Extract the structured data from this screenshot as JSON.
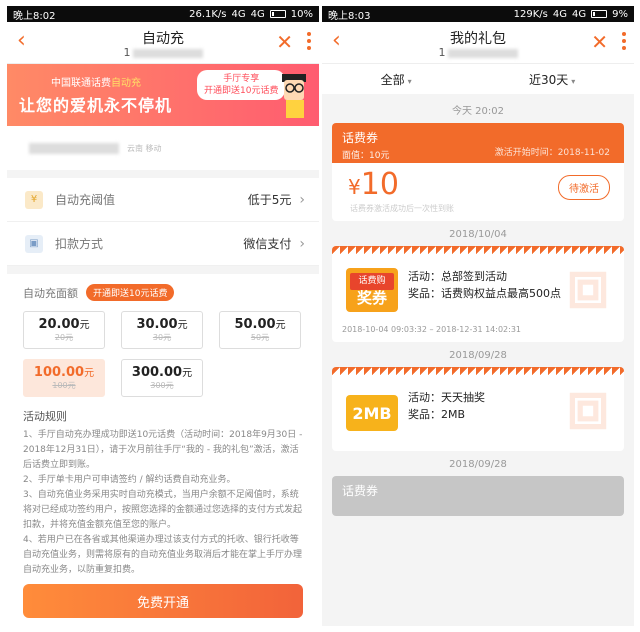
{
  "left": {
    "status": {
      "time": "晚上8:02",
      "net": "26.1K/s",
      "signal": "4G",
      "signal2": "4G",
      "battery": "10%"
    },
    "nav": {
      "title": "自动充",
      "subtitle": "1"
    },
    "banner": {
      "small_prefix": "中国联通话费",
      "small_highlight": "自动充",
      "headline": "让您的爱机永不停机",
      "bubble_line1": "手厅专享",
      "bubble_line2": "开通即送10元话费"
    },
    "account": {
      "location": "云南 移动"
    },
    "rows": [
      {
        "label": "自动充阈值",
        "value": "低于5元",
        "icon": "yen-coin-icon"
      },
      {
        "label": "扣款方式",
        "value": "微信支付",
        "icon": "bag-icon"
      }
    ],
    "amount": {
      "label": "自动充面额",
      "promo": "开通即送10元话费",
      "options": [
        {
          "price": "20.00",
          "unit": "元",
          "orig": "20元"
        },
        {
          "price": "30.00",
          "unit": "元",
          "orig": "30元"
        },
        {
          "price": "50.00",
          "unit": "元",
          "orig": "50元"
        },
        {
          "price": "100.00",
          "unit": "元",
          "orig": "100元"
        },
        {
          "price": "300.00",
          "unit": "元",
          "orig": "300元"
        }
      ]
    },
    "rules": {
      "title": "活动规则",
      "items": [
        "1、手厅自动充办理成功即送10元话费（活动时间：2018年9月30日 - 2018年12月31日），请于次月前往手厅“我的 - 我的礼包”激活，激活后话费立即到账。",
        "2、手厅单卡用户可申请签约 / 解约话费自动充业务。",
        "3、自动充值业务采用实时自动充模式，当用户余额不足阈值时，系统将对已经成功签约用户，按照您选择的金额通过您选择的支付方式发起扣款，并将充值金额充值至您的账户。",
        "4、若用户已在各省或其他渠道办理过该支付方式的托收、银行托收等自动充值业务，则需将原有的自动充值业务取消后才能在掌上手厅办理自动充业务，以防重复扣费。"
      ]
    },
    "cta": "免费开通"
  },
  "right": {
    "status": {
      "time": "晚上8:03",
      "net": "129K/s",
      "signal": "4G",
      "signal2": "4G",
      "battery": "9%"
    },
    "nav": {
      "title": "我的礼包",
      "subtitle": "1"
    },
    "filters": {
      "all": "全部",
      "range": "近30天"
    },
    "dates": [
      "今天 20:02",
      "2018/10/04",
      "2018/09/28",
      "2018/09/28"
    ],
    "coupon": {
      "type": "话费券",
      "face": "面值：10元",
      "start": "激活开始时间：2018-11-02",
      "currency": "¥",
      "amount": "10",
      "note": "话费券激活成功后一次性到账",
      "action": "待激活"
    },
    "gift1": {
      "logo_top": "话费购",
      "logo_bottom": "奖券",
      "activity": "活动：总部签到活动",
      "prize": "奖品：话费购权益点最高500点",
      "time": "2018-10-04 09:03:32 – 2018-12-31 14:02:31"
    },
    "gift2": {
      "logo": "2MB",
      "activity": "活动：天天抽奖",
      "prize": "奖品：2MB"
    },
    "coupon2": {
      "type": "话费券"
    }
  }
}
